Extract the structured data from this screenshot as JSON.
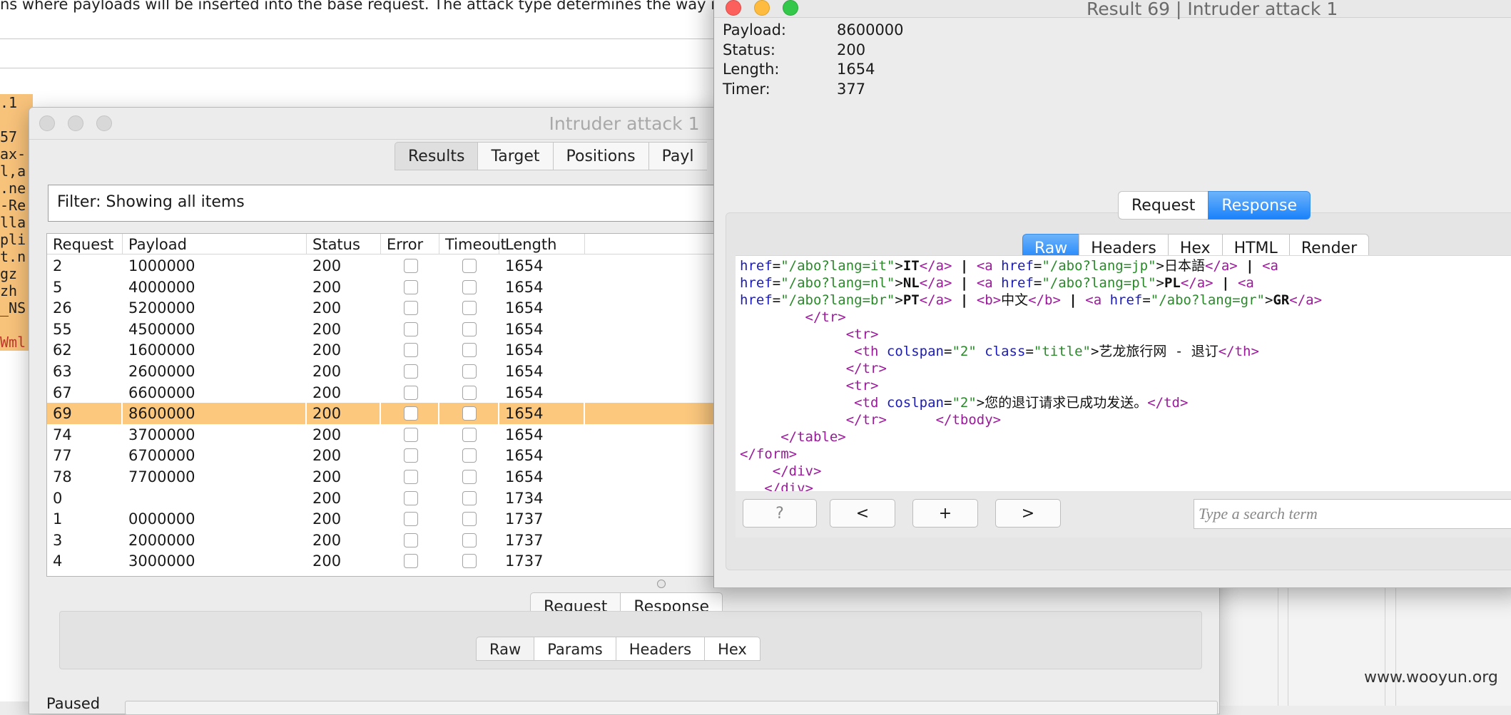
{
  "background": {
    "description_text": "ns where payloads will be inserted into the base request. The attack type determines the way in",
    "code_fragments": [
      ".1",
      "",
      "57",
      "ax-",
      "l,a",
      ".ne",
      "-Re",
      "lla",
      "pli",
      "t.n",
      " gz",
      " zh",
      "_NS",
      "",
      "Wml"
    ]
  },
  "intruder": {
    "title": "Intruder attack 1",
    "tabs": [
      {
        "label": "Results",
        "selected": true
      },
      {
        "label": "Target",
        "selected": false
      },
      {
        "label": "Positions",
        "selected": false
      },
      {
        "label": "Payl",
        "selected": false
      }
    ],
    "filter_text": "Filter: Showing all items",
    "columns": {
      "request": "Request",
      "payload": "Payload",
      "status": "Status",
      "error": "Error",
      "timeout": "Timeout",
      "length": "Length"
    },
    "rows": [
      {
        "request": "2",
        "payload": "1000000",
        "status": "200",
        "length": "1654",
        "selected": false
      },
      {
        "request": "5",
        "payload": "4000000",
        "status": "200",
        "length": "1654",
        "selected": false
      },
      {
        "request": "26",
        "payload": "5200000",
        "status": "200",
        "length": "1654",
        "selected": false
      },
      {
        "request": "55",
        "payload": "4500000",
        "status": "200",
        "length": "1654",
        "selected": false
      },
      {
        "request": "62",
        "payload": "1600000",
        "status": "200",
        "length": "1654",
        "selected": false
      },
      {
        "request": "63",
        "payload": "2600000",
        "status": "200",
        "length": "1654",
        "selected": false
      },
      {
        "request": "67",
        "payload": "6600000",
        "status": "200",
        "length": "1654",
        "selected": false
      },
      {
        "request": "69",
        "payload": "8600000",
        "status": "200",
        "length": "1654",
        "selected": true
      },
      {
        "request": "74",
        "payload": "3700000",
        "status": "200",
        "length": "1654",
        "selected": false
      },
      {
        "request": "77",
        "payload": "6700000",
        "status": "200",
        "length": "1654",
        "selected": false
      },
      {
        "request": "78",
        "payload": "7700000",
        "status": "200",
        "length": "1654",
        "selected": false
      },
      {
        "request": "0",
        "payload": "",
        "status": "200",
        "length": "1734",
        "selected": false
      },
      {
        "request": "1",
        "payload": "0000000",
        "status": "200",
        "length": "1737",
        "selected": false
      },
      {
        "request": "3",
        "payload": "2000000",
        "status": "200",
        "length": "1737",
        "selected": false
      },
      {
        "request": "4",
        "payload": "3000000",
        "status": "200",
        "length": "1737",
        "selected": false
      }
    ],
    "lower_tabs": {
      "request": "Request",
      "response": "Response"
    },
    "view_tabs": [
      "Raw",
      "Params",
      "Headers",
      "Hex"
    ],
    "status_text": "Paused"
  },
  "result": {
    "title": "Result 69 | Intruder attack 1",
    "info": [
      {
        "label": "Payload:",
        "value": "8600000"
      },
      {
        "label": "Status:",
        "value": "200"
      },
      {
        "label": "Length:",
        "value": "1654"
      },
      {
        "label": "Timer:",
        "value": "377"
      }
    ],
    "reqresp_tabs": {
      "request": "Request",
      "response": "Response",
      "active": "Response"
    },
    "view_tabs": [
      {
        "label": "Raw",
        "active": true
      },
      {
        "label": "Headers",
        "active": false
      },
      {
        "label": "Hex",
        "active": false
      },
      {
        "label": "HTML",
        "active": false
      },
      {
        "label": "Render",
        "active": false
      }
    ],
    "code_lines": [
      [
        [
          "a",
          "href"
        ],
        [
          "tx",
          "="
        ],
        [
          "v",
          "\"/abo?lang=it\""
        ],
        [
          "tx",
          ">"
        ],
        [
          "tx",
          "IT"
        ],
        [
          "t",
          "</a>"
        ],
        [
          "tx",
          " | "
        ],
        [
          "t",
          "<a "
        ],
        [
          "a",
          "href"
        ],
        [
          "tx",
          "="
        ],
        [
          "v",
          "\"/abo?lang=jp\""
        ],
        [
          "tx",
          ">日本語"
        ],
        [
          "t",
          "</a>"
        ],
        [
          "tx",
          " | "
        ],
        [
          "t",
          "<a"
        ]
      ],
      [
        [
          "a",
          "href"
        ],
        [
          "tx",
          "="
        ],
        [
          "v",
          "\"/abo?lang=nl\""
        ],
        [
          "tx",
          ">"
        ],
        [
          "tx",
          "NL"
        ],
        [
          "t",
          "</a>"
        ],
        [
          "tx",
          " | "
        ],
        [
          "t",
          "<a "
        ],
        [
          "a",
          "href"
        ],
        [
          "tx",
          "="
        ],
        [
          "v",
          "\"/abo?lang=pl\""
        ],
        [
          "tx",
          ">"
        ],
        [
          "tx",
          "PL"
        ],
        [
          "t",
          "</a>"
        ],
        [
          "tx",
          " | "
        ],
        [
          "t",
          "<a"
        ]
      ],
      [
        [
          "a",
          "href"
        ],
        [
          "tx",
          "="
        ],
        [
          "v",
          "\"/abo?lang=br\""
        ],
        [
          "tx",
          ">"
        ],
        [
          "tx",
          "PT"
        ],
        [
          "t",
          "</a>"
        ],
        [
          "tx",
          " | "
        ],
        [
          "t",
          "<b>"
        ],
        [
          "tx",
          "中文"
        ],
        [
          "t",
          "</b>"
        ],
        [
          "tx",
          " | "
        ],
        [
          "t",
          "<a "
        ],
        [
          "a",
          "href"
        ],
        [
          "tx",
          "="
        ],
        [
          "v",
          "\"/abo?lang=gr\""
        ],
        [
          "tx",
          ">"
        ],
        [
          "tx",
          "GR"
        ],
        [
          "t",
          "</a>"
        ]
      ],
      [
        [
          "tx",
          "        "
        ],
        [
          "t",
          "</tr>"
        ]
      ],
      [
        [
          "tx",
          "             "
        ],
        [
          "t",
          "<tr>"
        ]
      ],
      [
        [
          "tx",
          "              "
        ],
        [
          "t",
          "<th "
        ],
        [
          "a",
          "colspan"
        ],
        [
          "tx",
          "="
        ],
        [
          "v",
          "\"2\""
        ],
        [
          "tx",
          " "
        ],
        [
          "a",
          "class"
        ],
        [
          "tx",
          "="
        ],
        [
          "v",
          "\"title\""
        ],
        [
          "tx",
          ">艺龙旅行网 - 退订"
        ],
        [
          "t",
          "</th>"
        ]
      ],
      [
        [
          "tx",
          "             "
        ],
        [
          "t",
          "</tr>"
        ]
      ],
      [
        [
          "tx",
          "             "
        ],
        [
          "t",
          "<tr>"
        ]
      ],
      [
        [
          "tx",
          "              "
        ],
        [
          "t",
          "<td "
        ],
        [
          "a",
          "coslpan"
        ],
        [
          "tx",
          "="
        ],
        [
          "v",
          "\"2\""
        ],
        [
          "tx",
          ">您的退订请求已成功发送。"
        ],
        [
          "t",
          "</td>"
        ]
      ],
      [
        [
          "tx",
          "             "
        ],
        [
          "t",
          "</tr>"
        ],
        [
          "tx",
          "      "
        ],
        [
          "t",
          "</tbody>"
        ]
      ],
      [
        [
          "tx",
          "     "
        ],
        [
          "t",
          "</table>"
        ]
      ],
      [
        [
          "t",
          "</form>"
        ]
      ],
      [
        [
          "tx",
          "    "
        ],
        [
          "t",
          "</div>"
        ]
      ],
      [
        [
          "tx",
          "   "
        ],
        [
          "t",
          "</div>"
        ]
      ]
    ],
    "footer": {
      "help": "?",
      "prev": "<",
      "add": "+",
      "next": ">",
      "search_placeholder": "Type a search term"
    }
  },
  "watermark": "www.wooyun.org"
}
